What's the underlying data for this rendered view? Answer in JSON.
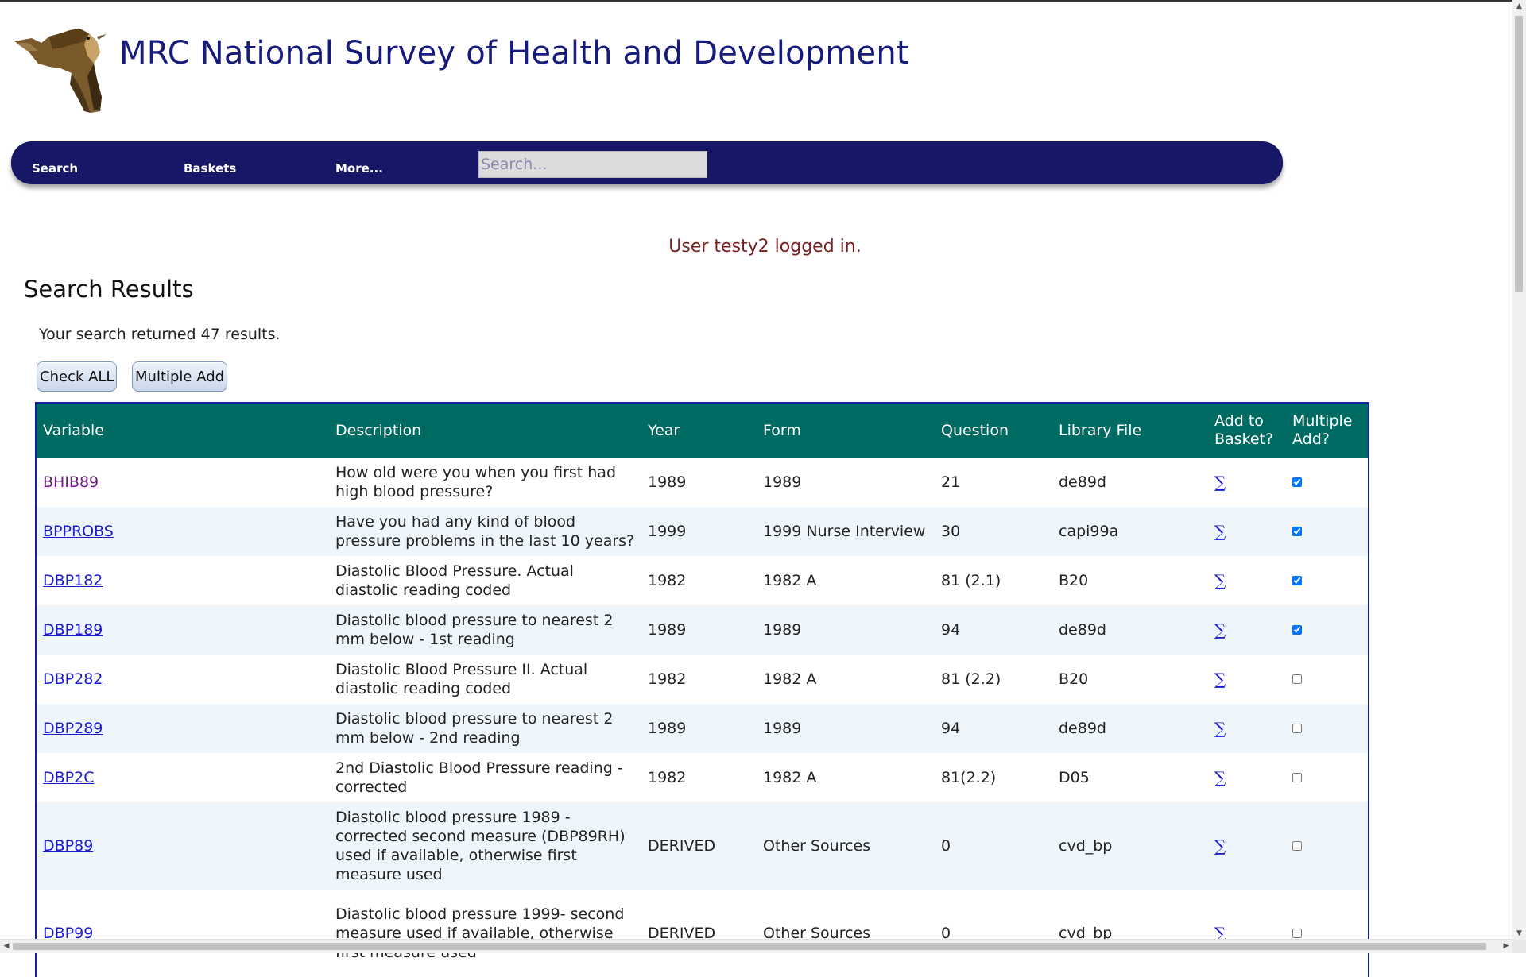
{
  "site": {
    "title": "MRC National Survey of Health and Development",
    "logo_icon": "skylark-bird-icon"
  },
  "nav": {
    "items": [
      "Search",
      "Baskets",
      "More..."
    ],
    "search_placeholder": "Search..."
  },
  "login_message": "User testy2 logged in.",
  "results": {
    "heading": "Search Results",
    "count_text": "Your search returned 47 results.",
    "buttons": {
      "check_all": "Check ALL",
      "multiple_add": "Multiple Add"
    }
  },
  "table": {
    "columns": [
      "Variable",
      "Description",
      "Year",
      "Form",
      "Question",
      "Library File",
      "Add to Basket?",
      "Multiple Add?"
    ],
    "basket_symbol": "∑",
    "rows": [
      {
        "variable": "BHIB89",
        "description": "How old were you when you first had high blood pressure?",
        "year": "1989",
        "form": "1989",
        "question": "21",
        "library_file": "de89d",
        "checked": true,
        "visited": true
      },
      {
        "variable": "BPPROBS",
        "description": "Have you had any kind of blood pressure problems in the last 10 years?",
        "year": "1999",
        "form": "1999 Nurse Interview",
        "question": "30",
        "library_file": "capi99a",
        "checked": true,
        "visited": false
      },
      {
        "variable": "DBP182",
        "description": "Diastolic Blood Pressure. Actual diastolic reading coded",
        "year": "1982",
        "form": "1982 A",
        "question": "81 (2.1)",
        "library_file": "B20",
        "checked": true,
        "visited": false
      },
      {
        "variable": "DBP189",
        "description": "Diastolic blood pressure to nearest 2 mm below - 1st reading",
        "year": "1989",
        "form": "1989",
        "question": "94",
        "library_file": "de89d",
        "checked": true,
        "visited": false
      },
      {
        "variable": "DBP282",
        "description": "Diastolic Blood Pressure II. Actual diastolic reading coded",
        "year": "1982",
        "form": "1982 A",
        "question": "81 (2.2)",
        "library_file": "B20",
        "checked": false,
        "visited": false
      },
      {
        "variable": "DBP289",
        "description": "Diastolic blood pressure to nearest 2 mm below - 2nd reading",
        "year": "1989",
        "form": "1989",
        "question": "94",
        "library_file": "de89d",
        "checked": false,
        "visited": false
      },
      {
        "variable": "DBP2C",
        "description": "2nd Diastolic Blood Pressure reading - corrected",
        "year": "1982",
        "form": "1982 A",
        "question": "81(2.2)",
        "library_file": "D05",
        "checked": false,
        "visited": false
      },
      {
        "variable": "DBP89",
        "description": "Diastolic blood pressure 1989 - corrected second measure (DBP89RH) used if available, otherwise first measure used",
        "year": "DERIVED",
        "form": "Other Sources",
        "question": "0",
        "library_file": "cvd_bp",
        "checked": false,
        "visited": false,
        "tall": true
      },
      {
        "variable": "DBP99",
        "description": "Diastolic blood pressure 1999- second measure used if available, otherwise first measure used",
        "year": "DERIVED",
        "form": "Other Sources",
        "question": "0",
        "library_file": "cvd_bp",
        "checked": false,
        "visited": false,
        "tall": true
      }
    ]
  }
}
